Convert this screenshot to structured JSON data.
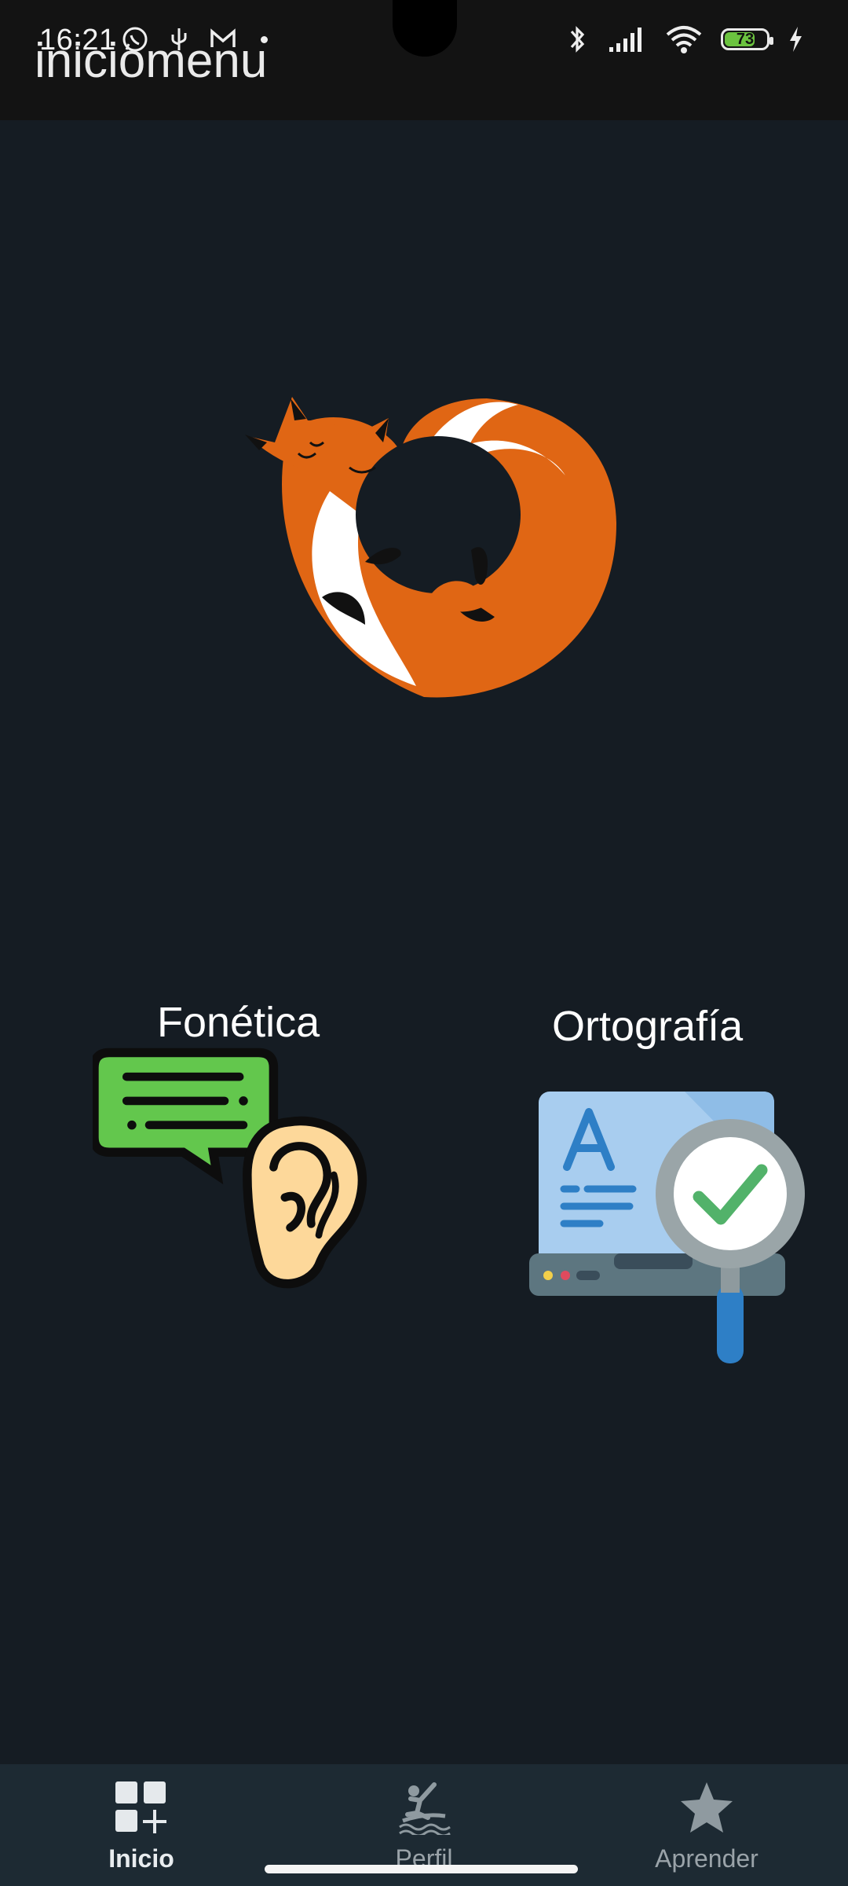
{
  "status_bar": {
    "time": "16:21",
    "battery_level": "73",
    "battery_fraction": 0.73,
    "left_icons": [
      "whatsapp-icon",
      "usb-icon",
      "gmail-icon"
    ],
    "right_icons": [
      "bluetooth-icon",
      "signal-icon",
      "wifi-icon",
      "battery-icon",
      "charging-icon"
    ]
  },
  "app_bar": {
    "title": "iniciomenu"
  },
  "logo": {
    "name": "fox-logo",
    "colors": {
      "orange": "#e06614",
      "white": "#ffffff",
      "dark": "#151c23"
    }
  },
  "cards": [
    {
      "label": "Fonética",
      "icon": "speech-ear-icon"
    },
    {
      "label": "Ortografía",
      "icon": "spellcheck-magnifier-icon"
    }
  ],
  "bottom_nav": {
    "items": [
      {
        "label": "Inicio",
        "icon": "grid-add-icon",
        "active": true
      },
      {
        "label": "Perfil",
        "icon": "surfer-icon",
        "active": false
      },
      {
        "label": "Aprender",
        "icon": "star-icon",
        "active": false
      }
    ]
  },
  "theme": {
    "background": "#151c23",
    "top_bar": "#131313",
    "nav_bar": "#1d2a33",
    "accent_orange": "#e06614"
  }
}
